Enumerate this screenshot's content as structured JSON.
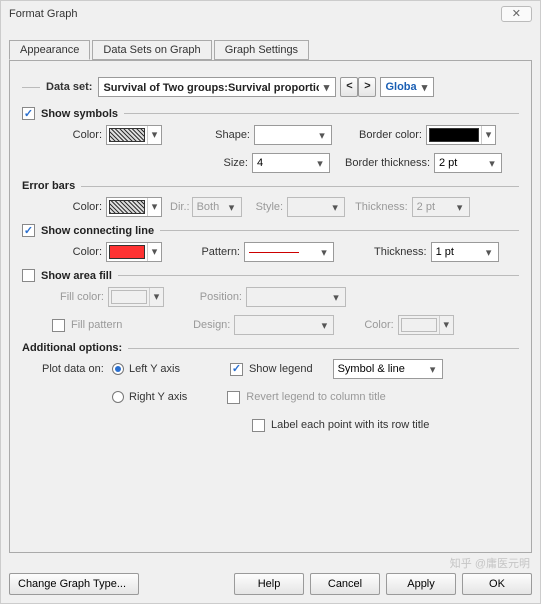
{
  "window": {
    "title": "Format Graph"
  },
  "tabs": [
    "Appearance",
    "Data Sets on Graph",
    "Graph Settings"
  ],
  "dataset": {
    "label": "Data set:",
    "value": "Survival of Two groups:Survival proportions:A: 对照组",
    "prev": "<",
    "next": ">",
    "global": "Global"
  },
  "symbols": {
    "title": "Show symbols",
    "color": "Color:",
    "shape": "Shape:",
    "border_color": "Border color:",
    "size": "Size:",
    "size_val": "4",
    "border_thick": "Border thickness:",
    "border_thick_val": "2 pt"
  },
  "error": {
    "title": "Error bars",
    "color": "Color:",
    "dir": "Dir.:",
    "dir_val": "Both",
    "style": "Style:",
    "thick": "Thickness:",
    "thick_val": "2 pt"
  },
  "conn": {
    "title": "Show connecting line",
    "color": "Color:",
    "pattern": "Pattern:",
    "thick": "Thickness:",
    "thick_val": "1 pt"
  },
  "area": {
    "title": "Show area fill",
    "fill_color": "Fill color:",
    "position": "Position:",
    "fill_pattern": "Fill pattern",
    "design": "Design:",
    "color": "Color:"
  },
  "addl": {
    "title": "Additional options:",
    "plot_on": "Plot data on:",
    "left": "Left Y axis",
    "right": "Right Y axis",
    "legend": "Show legend",
    "legend_combo": "Symbol & line",
    "revert": "Revert legend to column title",
    "labelrow": "Label each point with its row title"
  },
  "footer": {
    "change": "Change Graph Type...",
    "help": "Help",
    "cancel": "Cancel",
    "apply": "Apply",
    "ok": "OK"
  },
  "watermark": "知乎 @庸医元明"
}
